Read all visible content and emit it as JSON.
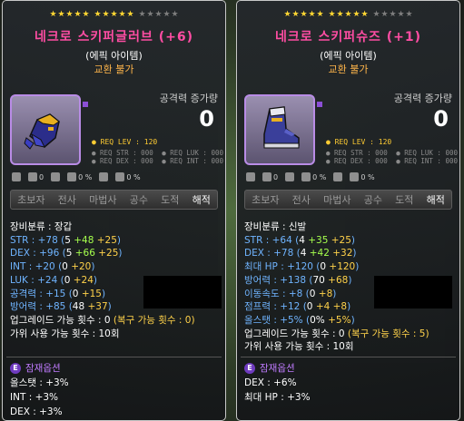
{
  "left": {
    "stars_on": 10,
    "stars_off": 5,
    "title": "네크로 스키퍼글러브 (+6)",
    "grade": "(에픽 아이템)",
    "untradable": "교환 불가",
    "attack_label": "공격력 증가량",
    "attack_value": "0",
    "req_lev": "● REQ LEV : 120",
    "req_rows": [
      [
        "● REQ STR : 000",
        "● REQ LUK : 000"
      ],
      [
        "● REQ DEX : 000",
        "● REQ INT : 000"
      ]
    ],
    "mini_icons": [
      "0",
      "0 %",
      "0 %"
    ],
    "jobs": [
      "초보자",
      "전사",
      "마법사",
      "공수",
      "도적",
      "해적"
    ],
    "stats": {
      "category": "장비분류 : 장갑",
      "str": {
        "name": "STR : +78 (",
        "base": "5",
        "bonus": " +48",
        "star": " +25",
        "end": ")"
      },
      "dex": {
        "name": "DEX : +96 (",
        "base": "5",
        "bonus": " +66",
        "star": " +25",
        "end": ")"
      },
      "int": {
        "name": "INT : +20 (",
        "base": "0",
        "bonus": "",
        "star": " +20",
        "end": ")"
      },
      "luk": {
        "name": "LUK : +24 (",
        "base": "0",
        "bonus": "",
        "star": " +24",
        "end": ")"
      },
      "atk": {
        "name": "공격력 : +15 (",
        "base": "0",
        "bonus": "",
        "star": " +15",
        "end": ")"
      },
      "def": {
        "name": "방어력 : +85 (",
        "base": "48",
        "bonus": "",
        "star": " +37",
        "end": ")"
      },
      "upgrade": "업그레이드 가능 횟수 : 0 ",
      "upgrade_restore": "(복구 가능 횟수 : 0)",
      "scissors": "가위 사용 가능 횟수 : 10회"
    },
    "potential_title": "잠재옵션",
    "potential": [
      "올스탯 : +3%",
      "INT : +3%",
      "DEX : +3%"
    ]
  },
  "right": {
    "stars_on": 10,
    "stars_off": 5,
    "title": "네크로 스키퍼슈즈 (+1)",
    "grade": "(에픽 아이템)",
    "untradable": "교환 불가",
    "attack_label": "공격력 증가량",
    "attack_value": "0",
    "req_lev": "● REQ LEV : 120",
    "req_rows": [
      [
        "● REQ STR : 000",
        "● REQ LUK : 000"
      ],
      [
        "● REQ DEX : 000",
        "● REQ INT : 000"
      ]
    ],
    "mini_icons": [
      "0",
      "0 %",
      "0 %"
    ],
    "jobs": [
      "초보자",
      "전사",
      "마법사",
      "공수",
      "도적",
      "해적"
    ],
    "stats": {
      "category": "장비분류 : 신발",
      "str": {
        "name": "STR : +64 (",
        "base": "4",
        "bonus": " +35",
        "star": " +25",
        "end": ")"
      },
      "dex": {
        "name": "DEX : +78 (",
        "base": "4",
        "bonus": " +42",
        "star": " +32",
        "end": ")"
      },
      "hp": {
        "name": "최대 HP : +120 (",
        "base": "0",
        "bonus": "",
        "star": " +120",
        "end": ")"
      },
      "def": {
        "name": "방어력 : +138 (",
        "base": "70",
        "bonus": "",
        "star": " +68",
        "end": ")"
      },
      "spd": {
        "name": "이동속도 : +8 (",
        "base": "0",
        "bonus": "",
        "star": " +8",
        "end": ")"
      },
      "jmp": {
        "name": "점프력 : +12 (",
        "base": "0",
        "bonus": "",
        "star": " +4 +8",
        "end": ")"
      },
      "all": {
        "name": "올스탯 : +5% (",
        "base": "0%",
        "bonus": "",
        "star": " +5%",
        "end": ")"
      },
      "upgrade": "업그레이드 가능 횟수 : 0 ",
      "upgrade_restore": "(복구 가능 횟수 : 5)",
      "scissors": "가위 사용 가능 횟수 : 10회"
    },
    "potential_title": "잠재옵션",
    "potential": [
      "DEX : +6%",
      "최대 HP : +3%"
    ]
  },
  "colors": {
    "title": "#ff4da3",
    "star_on": "#ffd633",
    "stat_blue": "#6fb4ff",
    "bonus_green": "#a6ff4d",
    "star_orange": "#ffd24a",
    "potential": "#c07bff"
  },
  "icons": [
    "gloves-item-icon",
    "shoes-item-icon"
  ]
}
